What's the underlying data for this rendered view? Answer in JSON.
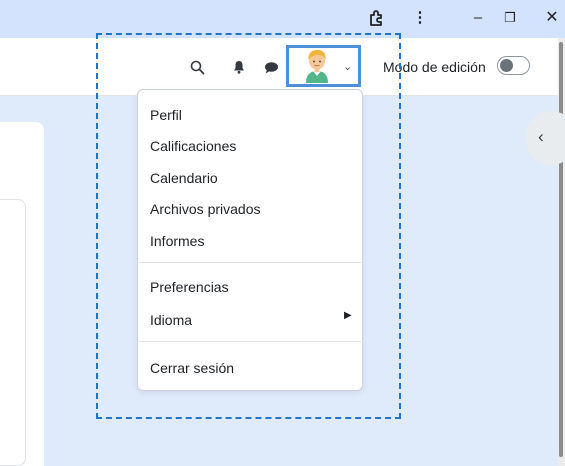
{
  "browser": {
    "extensions_icon": "puzzle-icon",
    "menu_icon": "⋮",
    "minimize_icon": "–",
    "restore_icon": "❐",
    "close_icon": "✕"
  },
  "navbar": {
    "search_icon": "search-icon",
    "notifications_icon": "bell-icon",
    "messages_icon": "chat-icon",
    "user_menu_caret": "⌄",
    "edit_mode_label": "Modo de edición",
    "edit_mode_on": false
  },
  "user_menu": {
    "items": [
      {
        "label": "Perfil"
      },
      {
        "label": "Calificaciones"
      },
      {
        "label": "Calendario"
      },
      {
        "label": "Archivos privados"
      },
      {
        "label": "Informes"
      },
      {
        "label": "Preferencias"
      },
      {
        "label": "Idioma",
        "submenu_arrow": "▶"
      },
      {
        "label": "Cerrar sesión"
      }
    ]
  },
  "drawer_toggle": {
    "icon": "‹"
  },
  "colors": {
    "highlight": "#1f73c9",
    "avatar_border": "#4f8ed8",
    "page_background": "#dfeafb"
  }
}
